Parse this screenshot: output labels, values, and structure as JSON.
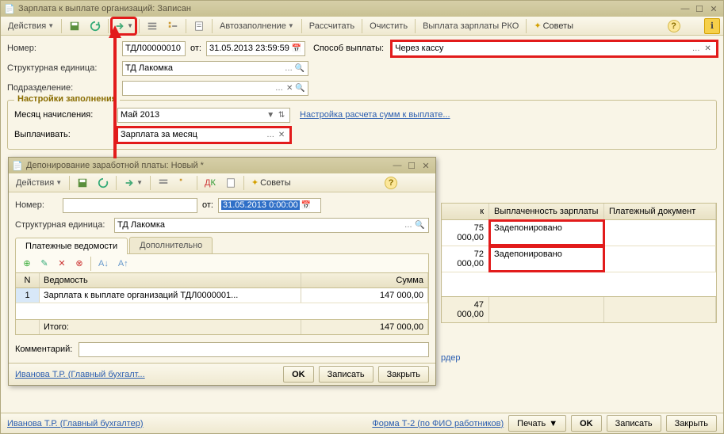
{
  "main": {
    "title": "Зарплата к выплате организаций: Записан",
    "toolbar": {
      "actions": "Действия",
      "autofill": "Автозаполнение",
      "calculate": "Рассчитать",
      "clear": "Очистить",
      "payout": "Выплата зарплаты РКО",
      "tips": "Советы"
    },
    "fields": {
      "number_lbl": "Номер:",
      "number": "ТДЛ00000010",
      "from_lbl": "от:",
      "date": "31.05.2013 23:59:59",
      "method_lbl": "Способ выплаты:",
      "method": "Через кассу",
      "org_lbl": "Структурная единица:",
      "org": "ТД Лакомка",
      "dept_lbl": "Подразделение:",
      "dept": ""
    },
    "group": {
      "legend": "Настройки заполнения",
      "month_lbl": "Месяц начисления:",
      "month": "Май 2013",
      "settings_link": "Настройка расчета сумм к выплате...",
      "pay_lbl": "Выплачивать:",
      "pay": "Зарплата за месяц"
    },
    "grid": {
      "h_sum": "к",
      "h_status": "Выплаченность зарплаты",
      "h_doc": "Платежный документ",
      "rows": [
        {
          "sum": "75 000,00",
          "status": "Задепонировано"
        },
        {
          "sum": "72 000,00",
          "status": "Задепонировано"
        }
      ],
      "total": "47 000,00",
      "rder": "рдер"
    },
    "footer": {
      "user": "Иванова Т.Р. (Главный бухгалтер)",
      "form": "Форма Т-2 (по ФИО работников)",
      "print": "Печать",
      "ok": "OK",
      "save": "Записать",
      "close": "Закрыть"
    }
  },
  "modal": {
    "title": "Депонирование заработной платы: Новый *",
    "toolbar": {
      "actions": "Действия",
      "tips": "Советы"
    },
    "fields": {
      "number_lbl": "Номер:",
      "number": "",
      "from_lbl": "от:",
      "date": "31.05.2013 0:00:00",
      "org_lbl": "Структурная единица:",
      "org": "ТД Лакомка"
    },
    "tabs": {
      "t1": "Платежные ведомости",
      "t2": "Дополнительно"
    },
    "grid": {
      "h_n": "N",
      "h_doc": "Ведомость",
      "h_sum": "Сумма",
      "rows": [
        {
          "n": "1",
          "doc": "Зарплата к выплате организаций ТДЛ0000001...",
          "sum": "147 000,00"
        }
      ],
      "total_lbl": "Итого:",
      "total": "147 000,00"
    },
    "comment_lbl": "Комментарий:",
    "footer": {
      "user": "Иванова Т.Р. (Главный бухгалт...",
      "ok": "OK",
      "save": "Записать",
      "close": "Закрыть"
    }
  }
}
